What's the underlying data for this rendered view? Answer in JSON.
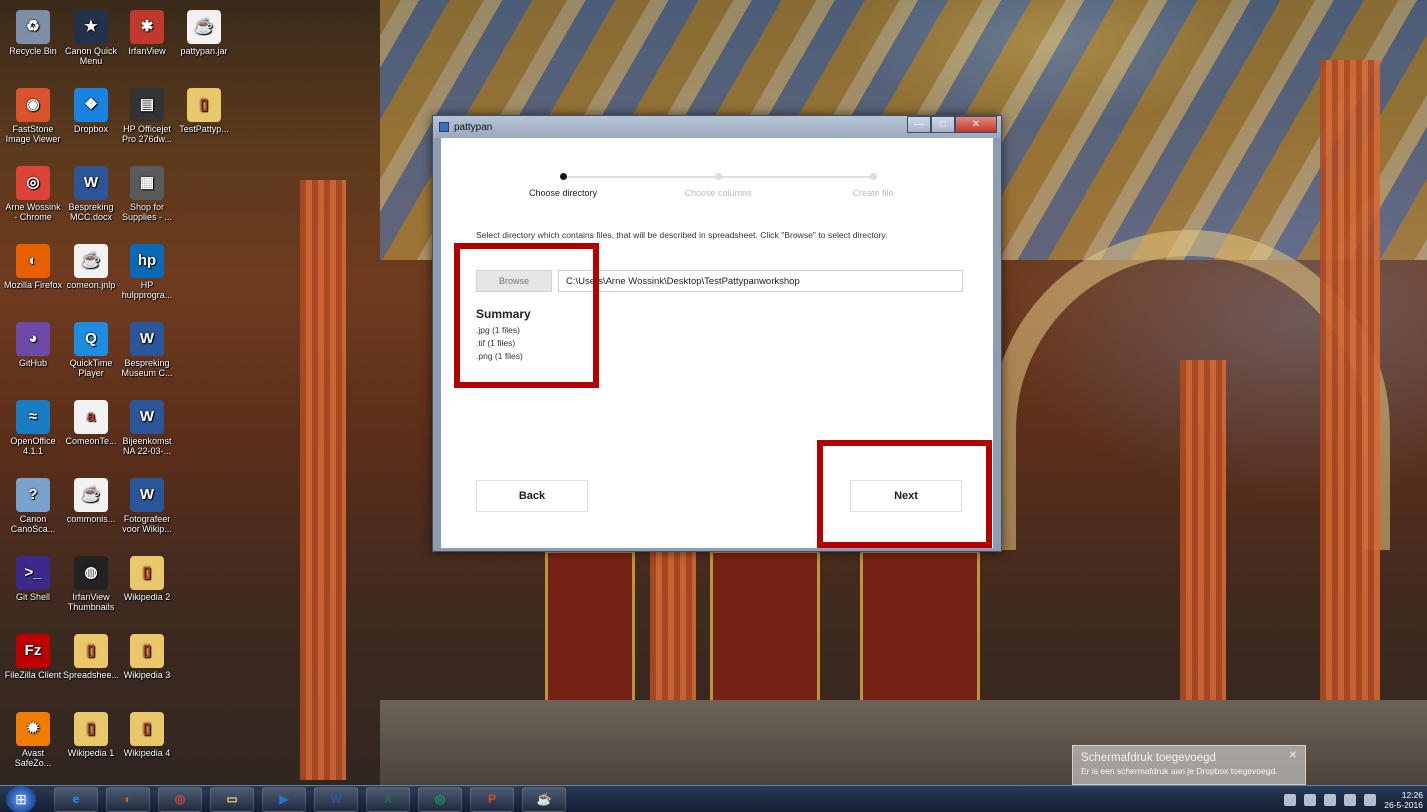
{
  "desktop": {
    "icons": [
      {
        "label": "Recycle Bin",
        "icon": "recycle-bin-icon",
        "color": "#7c8fa6",
        "glyph": "♻"
      },
      {
        "label": "Canon Quick Menu",
        "icon": "canon-quick-menu-icon",
        "color": "#23324a",
        "glyph": "★"
      },
      {
        "label": "IrfanView",
        "icon": "irfanview-icon",
        "color": "#c0392b",
        "glyph": "✱"
      },
      {
        "label": "pattypan.jar",
        "icon": "java-jar-icon",
        "color": "#f2f2f2",
        "glyph": "☕"
      },
      {
        "label": "FastStone Image Viewer",
        "icon": "faststone-eye-icon",
        "color": "#d9542c",
        "glyph": "◉"
      },
      {
        "label": "Dropbox",
        "icon": "dropbox-icon",
        "color": "#1a82e2",
        "glyph": "❖"
      },
      {
        "label": "HP Officejet Pro 276dw...",
        "icon": "printer-icon",
        "color": "#333333",
        "glyph": "▤"
      },
      {
        "label": "TestPattyp...",
        "icon": "folder-icon",
        "color": "#e8c86a",
        "glyph": "▯"
      },
      {
        "label": "Arne Wossink - Chrome",
        "icon": "chrome-icon",
        "color": "#db4437",
        "glyph": "◎"
      },
      {
        "label": "Bespreking MCC.docx",
        "icon": "word-doc-icon",
        "color": "#2b579a",
        "glyph": "W"
      },
      {
        "label": "Shop for Supplies - ...",
        "icon": "printer-shop-icon",
        "color": "#5a5a5a",
        "glyph": "▦"
      },
      {
        "label": "Mozilla Firefox",
        "icon": "firefox-icon",
        "color": "#e66000",
        "glyph": "◐"
      },
      {
        "label": "comeon.jnlp",
        "icon": "java-jnlp-icon",
        "color": "#f2f2f2",
        "glyph": "☕"
      },
      {
        "label": "HP hulpprogra...",
        "icon": "hp-icon",
        "color": "#0a6ab6",
        "glyph": "hp"
      },
      {
        "label": "GitHub",
        "icon": "github-icon",
        "color": "#6e4aa8",
        "glyph": "◕"
      },
      {
        "label": "QuickTime Player",
        "icon": "quicktime-icon",
        "color": "#1d8de0",
        "glyph": "Q"
      },
      {
        "label": "Bespreking Museum C...",
        "icon": "word-doc-icon",
        "color": "#2b579a",
        "glyph": "W"
      },
      {
        "label": "OpenOffice 4.1.1",
        "icon": "openoffice-icon",
        "color": "#1a7cc2",
        "glyph": "≈"
      },
      {
        "label": "ComeonTe...",
        "icon": "text-doc-icon",
        "color": "#f2f2f2",
        "glyph": "a"
      },
      {
        "label": "Bijeenkomst NA 22-03-...",
        "icon": "word-doc-icon",
        "color": "#2b579a",
        "glyph": "W"
      },
      {
        "label": "Canon CanoSca...",
        "icon": "canoscan-icon",
        "color": "#7aa2cf",
        "glyph": "?"
      },
      {
        "label": "commonis...",
        "icon": "java-file-icon",
        "color": "#f2f2f2",
        "glyph": "☕"
      },
      {
        "label": "Fotografeer voor Wikip...",
        "icon": "word-doc-icon",
        "color": "#2b579a",
        "glyph": "W"
      },
      {
        "label": "Git Shell",
        "icon": "git-shell-icon",
        "color": "#3b2a8c",
        "glyph": ">_"
      },
      {
        "label": "IrfanView Thumbnails",
        "icon": "panda-icon",
        "color": "#222222",
        "glyph": "◍"
      },
      {
        "label": "Wikipedia 2",
        "icon": "folder-icon",
        "color": "#e8c86a",
        "glyph": "▯"
      },
      {
        "label": "FileZilla Client",
        "icon": "filezilla-icon",
        "color": "#bf0000",
        "glyph": "Fz"
      },
      {
        "label": "Spreadshee...",
        "icon": "folder-icon",
        "color": "#e8c86a",
        "glyph": "▯"
      },
      {
        "label": "Wikipedia 3",
        "icon": "folder-icon",
        "color": "#e8c86a",
        "glyph": "▯"
      },
      {
        "label": "Avast SafeZo...",
        "icon": "avast-icon",
        "color": "#f07d00",
        "glyph": "✹"
      },
      {
        "label": "Wikipedia 1",
        "icon": "folder-icon",
        "color": "#e8c86a",
        "glyph": "▯"
      },
      {
        "label": "Wikipedia 4",
        "icon": "folder-icon",
        "color": "#e8c86a",
        "glyph": "▯"
      }
    ]
  },
  "window": {
    "title": "pattypan",
    "steps": [
      {
        "label": "Choose directory",
        "active": true
      },
      {
        "label": "Choose columns",
        "active": false
      },
      {
        "label": "Create file",
        "active": false
      }
    ],
    "instruction": "Select directory which contains files, that will be described in spreadsheet. Click \"Browse\" to select directory.",
    "browse_label": "Browse",
    "path_value": "C:\\Users\\Arne Wossink\\Desktop\\TestPattypanworkshop",
    "summary_title": "Summary",
    "summary_items": [
      ".jpg (1 files)",
      ".tif (1 files)",
      ".png (1 files)"
    ],
    "back_label": "Back",
    "next_label": "Next",
    "highlight_color": "#b30000"
  },
  "notification": {
    "title": "Schermafdruk toegevoegd",
    "body": "Er is een schermafdruk aan je Dropbox toegevoegd."
  },
  "taskbar": {
    "apps": [
      {
        "icon": "internet-explorer-icon",
        "glyph": "e",
        "color": "#1e90ff"
      },
      {
        "icon": "firefox-icon",
        "glyph": "◐",
        "color": "#e66000"
      },
      {
        "icon": "chrome-icon",
        "glyph": "◎",
        "color": "#db4437"
      },
      {
        "icon": "file-explorer-icon",
        "glyph": "▭",
        "color": "#e8c86a"
      },
      {
        "icon": "video-app-icon",
        "glyph": "▶",
        "color": "#1f77d0"
      },
      {
        "icon": "word-icon",
        "glyph": "W",
        "color": "#2b579a"
      },
      {
        "icon": "excel-icon",
        "glyph": "X",
        "color": "#217346"
      },
      {
        "icon": "chrome-app-icon",
        "glyph": "◎",
        "color": "#0f9d58"
      },
      {
        "icon": "powerpoint-icon",
        "glyph": "P",
        "color": "#d24726"
      },
      {
        "icon": "java-icon",
        "glyph": "☕",
        "color": "#f2f2f2"
      }
    ],
    "time": "12:26",
    "date": "26-5-2016"
  }
}
